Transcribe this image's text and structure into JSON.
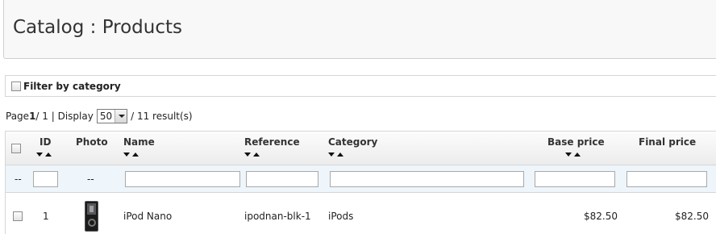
{
  "page": {
    "title": "Catalog : Products"
  },
  "filter": {
    "label": "Filter by category",
    "checked": false
  },
  "pager": {
    "page_prefix": "Page",
    "current_page": "1",
    "of_text": " / 1 | Display",
    "per_page": "50",
    "results_text": "/ 11 result(s)"
  },
  "table": {
    "headers": {
      "id": "ID",
      "photo": "Photo",
      "name": "Name",
      "reference": "Reference",
      "category": "Category",
      "base_price": "Base price",
      "final_price": "Final price"
    },
    "filter_row": {
      "first_dash": "--",
      "photo_dash": "--",
      "id_value": "",
      "name_value": "",
      "reference_value": "",
      "category_value": "",
      "base_price_value": "",
      "final_price_value": ""
    },
    "rows": [
      {
        "id": "1",
        "photo_icon": "ipod-nano-image",
        "name": "iPod Nano",
        "reference": "ipodnan-blk-1",
        "category": "iPods",
        "base_price": "$82.50",
        "final_price": "$82.50"
      }
    ]
  }
}
